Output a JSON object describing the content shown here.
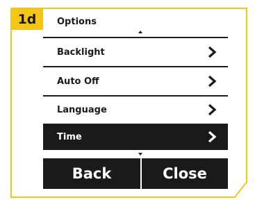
{
  "step": {
    "badge": "1d"
  },
  "screen": {
    "title": "Options",
    "menu_items": [
      {
        "label": "Backlight",
        "selected": false
      },
      {
        "label": "Auto Off",
        "selected": false
      },
      {
        "label": "Language",
        "selected": false
      },
      {
        "label": "Time",
        "selected": true
      }
    ],
    "softkeys": {
      "back": "Back",
      "close": "Close"
    }
  },
  "colors": {
    "accent_frame": "#f5c518",
    "screen_ink": "#1a1a1a",
    "screen_bg": "#ffffff"
  }
}
